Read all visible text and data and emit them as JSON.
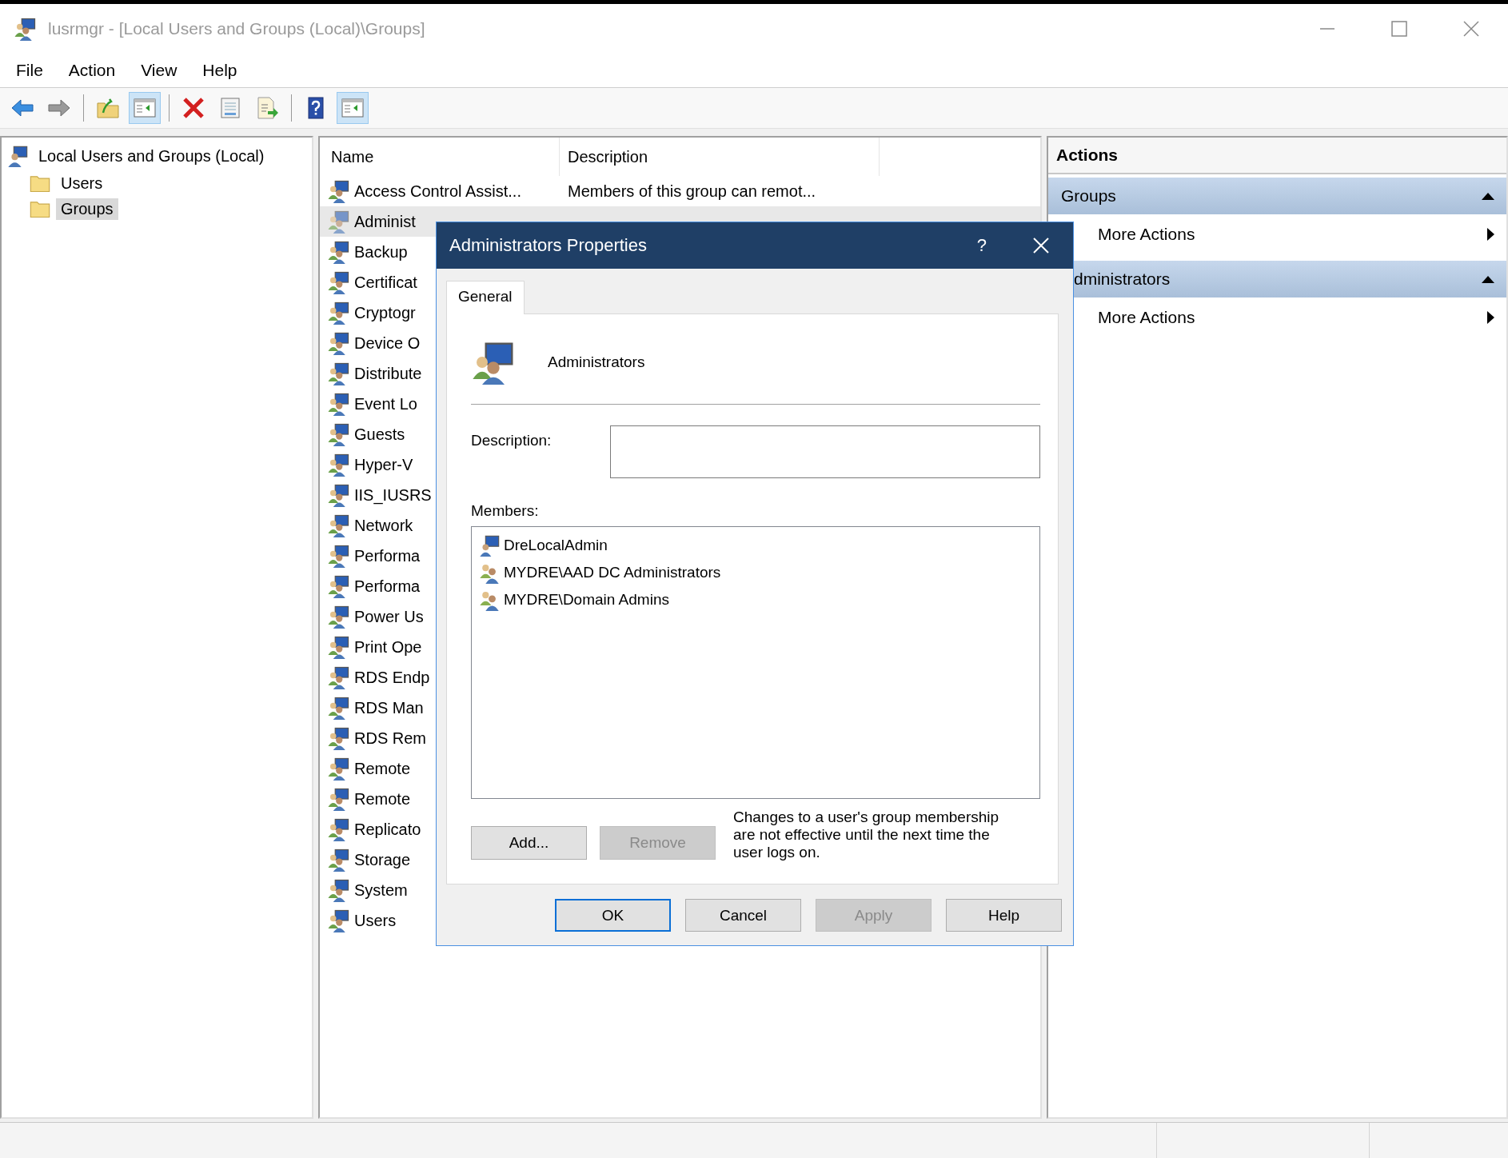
{
  "window": {
    "title": "lusrmgr - [Local Users and Groups (Local)\\Groups]"
  },
  "menu": [
    "File",
    "Action",
    "View",
    "Help"
  ],
  "toolbar": [
    {
      "kind": "button",
      "pressed": false
    },
    {
      "kind": "button",
      "pressed": false
    },
    {
      "kind": "separator"
    },
    {
      "kind": "button",
      "pressed": false
    },
    {
      "kind": "button",
      "pressed": true
    },
    {
      "kind": "separator"
    },
    {
      "kind": "button",
      "pressed": false
    },
    {
      "kind": "button",
      "pressed": false
    },
    {
      "kind": "button",
      "pressed": false
    },
    {
      "kind": "separator"
    },
    {
      "kind": "button",
      "pressed": false
    },
    {
      "kind": "button",
      "pressed": true
    }
  ],
  "tree": {
    "label": "Local Users and Groups (Local)",
    "children": [
      {
        "label": "Users",
        "selected": false
      },
      {
        "label": "Groups",
        "selected": true
      }
    ]
  },
  "table": {
    "columns": [
      "Name",
      "Description"
    ],
    "rows": [
      {
        "name": "Access Control Assist...",
        "description": "Members of this group can remot...",
        "selected": false
      },
      {
        "name": "Administ",
        "selected": true
      },
      {
        "name": "Backup",
        "selected": false
      },
      {
        "name": "Certificat",
        "selected": false
      },
      {
        "name": "Cryptogr",
        "selected": false
      },
      {
        "name": "Device O",
        "selected": false
      },
      {
        "name": "Distribute",
        "selected": false
      },
      {
        "name": "Event Lo",
        "selected": false
      },
      {
        "name": "Guests",
        "selected": false
      },
      {
        "name": "Hyper-V",
        "selected": false
      },
      {
        "name": "IIS_IUSRS",
        "selected": false
      },
      {
        "name": "Network",
        "selected": false
      },
      {
        "name": "Performa",
        "selected": false
      },
      {
        "name": "Performa",
        "selected": false
      },
      {
        "name": "Power Us",
        "selected": false
      },
      {
        "name": "Print Ope",
        "selected": false
      },
      {
        "name": "RDS Endp",
        "selected": false
      },
      {
        "name": "RDS Man",
        "selected": false
      },
      {
        "name": "RDS Rem",
        "selected": false
      },
      {
        "name": "Remote",
        "selected": false
      },
      {
        "name": "Remote",
        "selected": false
      },
      {
        "name": "Replicato",
        "selected": false
      },
      {
        "name": "Storage",
        "selected": false
      },
      {
        "name": "System",
        "selected": false
      },
      {
        "name": "Users",
        "selected": false
      }
    ]
  },
  "actions": {
    "title": "Actions",
    "sections": [
      {
        "title": "Groups",
        "expanded": true,
        "items": [
          "More Actions"
        ]
      },
      {
        "title": "dministrators",
        "expanded": true,
        "items": [
          "More Actions"
        ]
      }
    ]
  },
  "dialog": {
    "title": "Administrators Properties",
    "help": "?",
    "tabs": [
      {
        "label": "General",
        "selected": true
      }
    ],
    "group_name": "Administrators",
    "description_label": "Description:",
    "members_label": "Members:",
    "members": [
      {
        "name": "DreLocalAdmin",
        "kind": "user"
      },
      {
        "name": "MYDRE\\AAD DC Administrators",
        "kind": "group"
      },
      {
        "name": "MYDRE\\Domain Admins",
        "kind": "group"
      }
    ],
    "member_buttons": [
      {
        "label": "Add...",
        "disabled": false
      },
      {
        "label": "Remove",
        "disabled": true
      }
    ],
    "note": "Changes to a user's group membership are not effective until the next time the user logs on.",
    "buttons": [
      {
        "label": "OK",
        "default": true,
        "disabled": false
      },
      {
        "label": "Cancel",
        "default": false,
        "disabled": false
      },
      {
        "label": "Apply",
        "default": false,
        "disabled": true
      },
      {
        "label": "Help",
        "default": false,
        "disabled": false
      }
    ]
  }
}
